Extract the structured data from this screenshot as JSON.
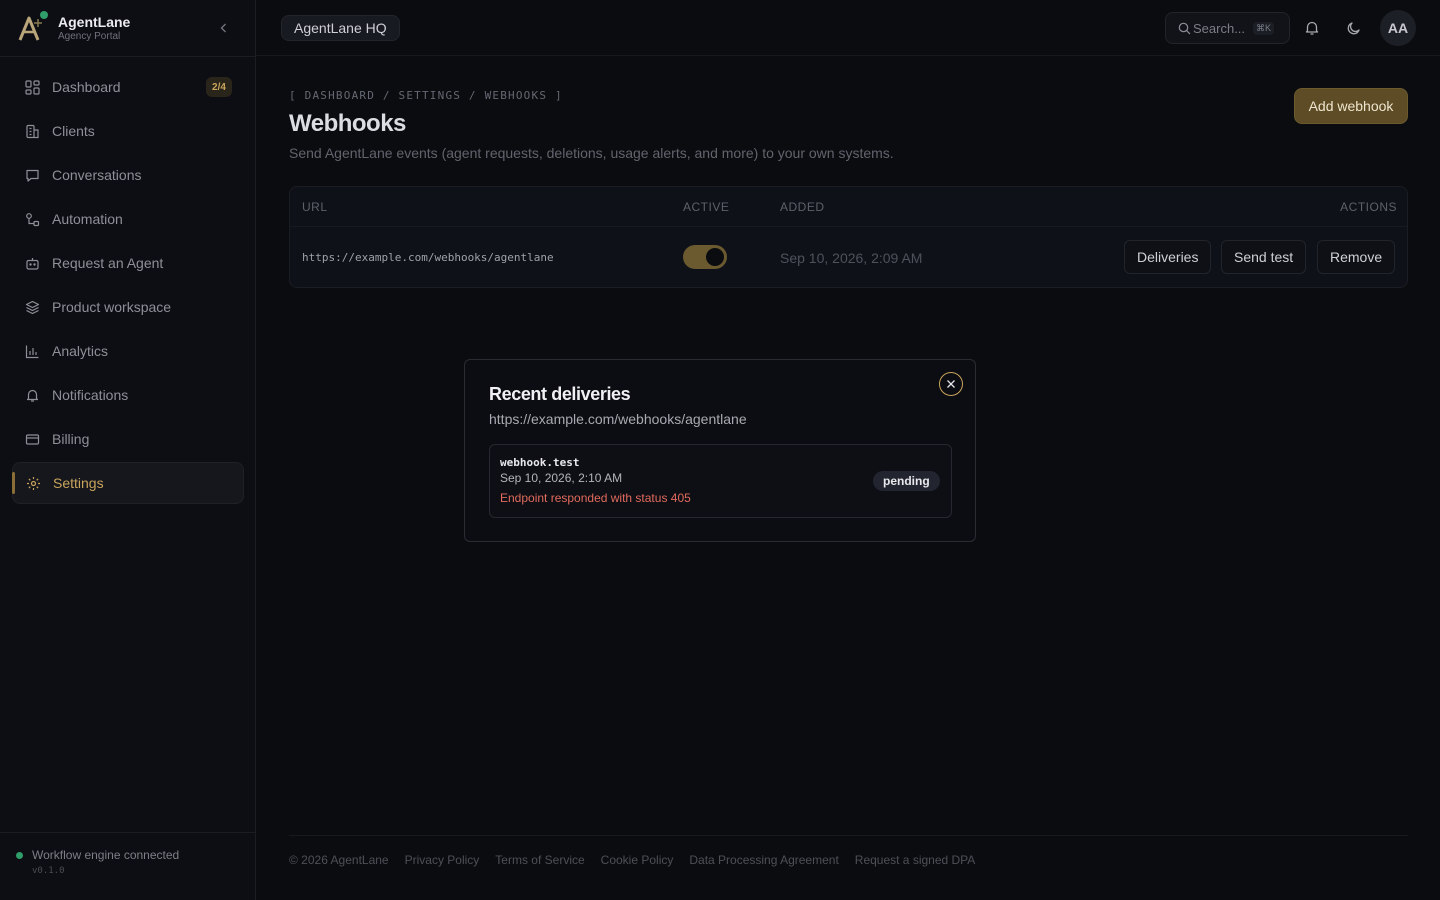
{
  "brand": {
    "name": "AgentLane",
    "subtitle": "Agency Portal"
  },
  "sidebar": {
    "items": [
      {
        "label": "Dashboard",
        "icon": "grid-icon",
        "badge": "2/4"
      },
      {
        "label": "Clients",
        "icon": "building-icon"
      },
      {
        "label": "Conversations",
        "icon": "chat-bubble-icon"
      },
      {
        "label": "Automation",
        "icon": "workflow-icon"
      },
      {
        "label": "Request an Agent",
        "icon": "bot-icon"
      },
      {
        "label": "Product workspace",
        "icon": "layers-icon"
      },
      {
        "label": "Analytics",
        "icon": "bar-chart-icon"
      },
      {
        "label": "Notifications",
        "icon": "bell-icon"
      },
      {
        "label": "Billing",
        "icon": "credit-card-icon"
      },
      {
        "label": "Settings",
        "icon": "gear-icon",
        "active": true
      }
    ],
    "footer": {
      "status": "Workflow engine connected",
      "version": "v0.1.0"
    }
  },
  "topbar": {
    "workspace": "AgentLane HQ",
    "search_placeholder": "Search...",
    "search_shortcut": "⌘K",
    "avatar_initials": "AA"
  },
  "page": {
    "breadcrumb": "[ DASHBOARD / SETTINGS / WEBHOOKS ]",
    "title": "Webhooks",
    "description": "Send AgentLane events (agent requests, deletions, usage alerts, and more) to your own systems.",
    "add_button": "Add webhook"
  },
  "table": {
    "columns": {
      "url": "URL",
      "active": "ACTIVE",
      "added": "ADDED",
      "actions": "ACTIONS"
    },
    "rows": [
      {
        "url": "https://example.com/webhooks/agentlane",
        "active": true,
        "added": "Sep 10, 2026, 2:09 AM",
        "actions": [
          "Deliveries",
          "Send test",
          "Remove"
        ]
      }
    ]
  },
  "modal": {
    "title": "Recent deliveries",
    "url": "https://example.com/webhooks/agentlane",
    "deliveries": [
      {
        "event": "webhook.test",
        "time": "Sep 10, 2026, 2:10 AM",
        "error": "Endpoint responded with status 405",
        "status": "pending"
      }
    ]
  },
  "footer": {
    "copyright": "© 2026 AgentLane",
    "links": [
      "Privacy Policy",
      "Terms of Service",
      "Cookie Policy",
      "Data Processing Agreement",
      "Request a signed DPA"
    ]
  },
  "colors": {
    "accent": "#c9a45c",
    "accent_bg": "#5d4c25",
    "background": "#0b0c10",
    "error": "#e26a5c",
    "online": "#2f9e6a"
  }
}
